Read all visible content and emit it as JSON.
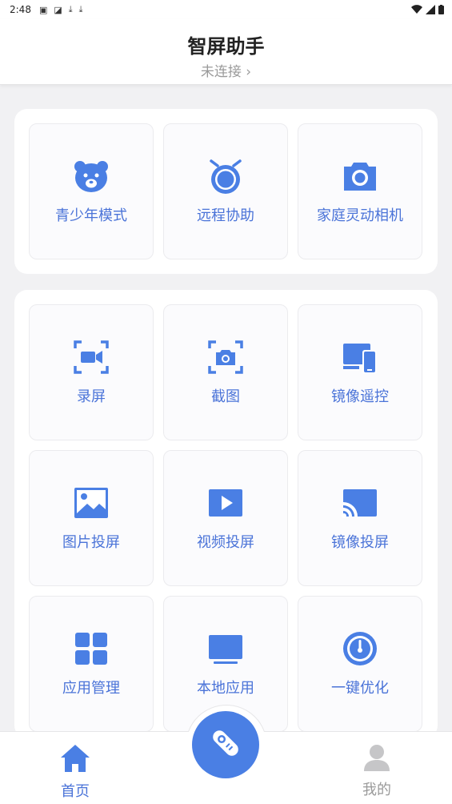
{
  "status_bar": {
    "time": "2:48"
  },
  "header": {
    "title": "智屏助手",
    "subtitle": "未连接 ›"
  },
  "top_card": {
    "tiles": [
      {
        "label": "青少年模式",
        "icon": "bear-icon"
      },
      {
        "label": "远程协助",
        "icon": "alarm-clock-icon"
      },
      {
        "label": "家庭灵动相机",
        "icon": "camera-icon"
      }
    ]
  },
  "tools_card": {
    "tiles": [
      {
        "label": "录屏",
        "icon": "screen-record-icon"
      },
      {
        "label": "截图",
        "icon": "screenshot-icon"
      },
      {
        "label": "镜像遥控",
        "icon": "mirror-remote-icon"
      },
      {
        "label": "图片投屏",
        "icon": "image-cast-icon"
      },
      {
        "label": "视频投屏",
        "icon": "video-cast-icon"
      },
      {
        "label": "镜像投屏",
        "icon": "screen-mirror-cast-icon"
      },
      {
        "label": "应用管理",
        "icon": "app-grid-icon"
      },
      {
        "label": "本地应用",
        "icon": "tv-icon"
      },
      {
        "label": "一键优化",
        "icon": "speed-gauge-icon"
      }
    ]
  },
  "tab_bar": {
    "home_label": "首页",
    "mine_label": "我的",
    "center_icon": "remote-control-icon"
  },
  "colors": {
    "accent": "#4a73d8",
    "fab": "#4a7fe4",
    "muted": "#9a9a9a"
  }
}
